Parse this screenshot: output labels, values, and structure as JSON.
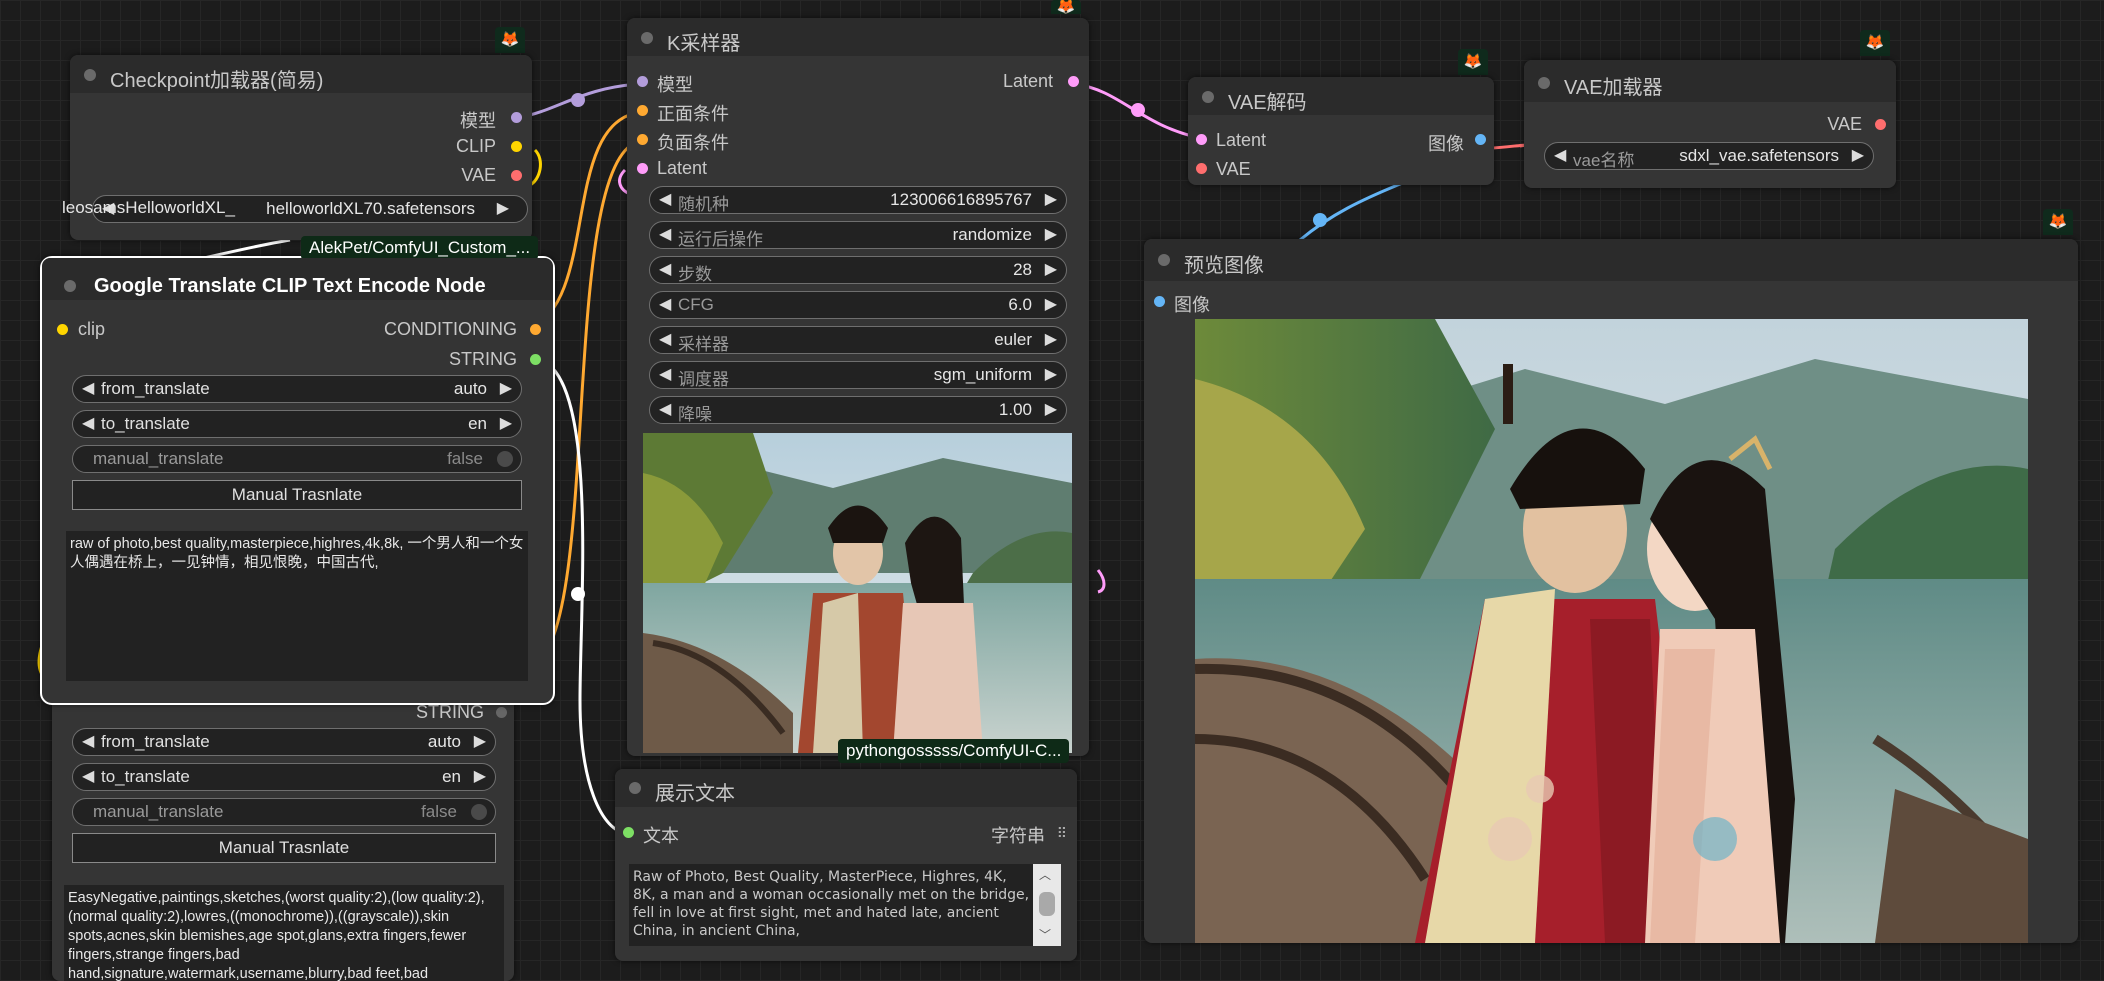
{
  "colors": {
    "model_port": "#b39ddb",
    "clip_port": "#ffd500",
    "vae_port": "#ff6e6e",
    "conditioning_port": "#ffa931",
    "latent_port": "#ff9cf9",
    "image_port": "#64b5f6",
    "string_port": "#7ddf64"
  },
  "checkpoint": {
    "title": "Checkpoint加载器(简易)",
    "out_model": "模型",
    "out_clip": "CLIP",
    "out_vae": "VAE",
    "ckpt_overlay_label": "leosamsHelloworldXL_",
    "ckpt_value": "helloworldXL70.safetensors",
    "icon": "fox-icon"
  },
  "translate1": {
    "badge": "AlekPet/ComfyUI_Custom_...",
    "title": "Google Translate CLIP Text Encode Node",
    "in_clip": "clip",
    "out_conditioning": "CONDITIONING",
    "out_string": "STRING",
    "from_label": "from_translate",
    "from_value": "auto",
    "to_label": "to_translate",
    "to_value": "en",
    "manual_label": "manual_translate",
    "manual_value": "false",
    "button": "Manual Trasnlate",
    "text": "raw of photo,best quality,masterpiece,highres,4k,8k, 一个男人和一个女人偶遇在桥上，一见钟情，相见恨晚，中国古代,"
  },
  "translate2": {
    "out_string": "STRING",
    "from_label": "from_translate",
    "from_value": "auto",
    "to_label": "to_translate",
    "to_value": "en",
    "manual_label": "manual_translate",
    "manual_value": "false",
    "button": "Manual Trasnlate",
    "text": "EasyNegative,paintings,sketches,(worst quality:2),(low quality:2),(normal quality:2),lowres,((monochrome)),((grayscale)),skin spots,acnes,skin blemishes,age spot,glans,extra fingers,fewer fingers,strange fingers,bad hand,signature,watermark,username,blurry,bad feet,bad"
  },
  "ksampler": {
    "title": "K采样器",
    "in_model": "模型",
    "in_positive": "正面条件",
    "in_negative": "负面条件",
    "in_latent": "Latent",
    "out_latent": "Latent",
    "widgets": [
      {
        "label": "随机种",
        "value": "123006616895767"
      },
      {
        "label": "运行后操作",
        "value": "randomize"
      },
      {
        "label": "步数",
        "value": "28"
      },
      {
        "label": "CFG",
        "value": "6.0"
      },
      {
        "label": "采样器",
        "value": "euler"
      },
      {
        "label": "调度器",
        "value": "sgm_uniform"
      },
      {
        "label": "降噪",
        "value": "1.00"
      }
    ],
    "badge": "pythongosssss/ComfyUI-C..."
  },
  "vae_decode": {
    "title": "VAE解码",
    "in_latent": "Latent",
    "in_vae": "VAE",
    "out_image": "图像"
  },
  "vae_loader": {
    "title": "VAE加载器",
    "out_vae": "VAE",
    "widget_label": "vae名称",
    "widget_value": "sdxl_vae.safetensors"
  },
  "preview": {
    "title": "预览图像",
    "in_image": "图像"
  },
  "show_text": {
    "title": "展示文本",
    "in_text": "文本",
    "out_string": "字符串",
    "text": "Raw of Photo, Best Quality, MasterPiece, Highres, 4K, 8K, a man and a woman occasionally met on the bridge, fell in love at first sight, met and hated late, ancient China, in ancient China,"
  }
}
